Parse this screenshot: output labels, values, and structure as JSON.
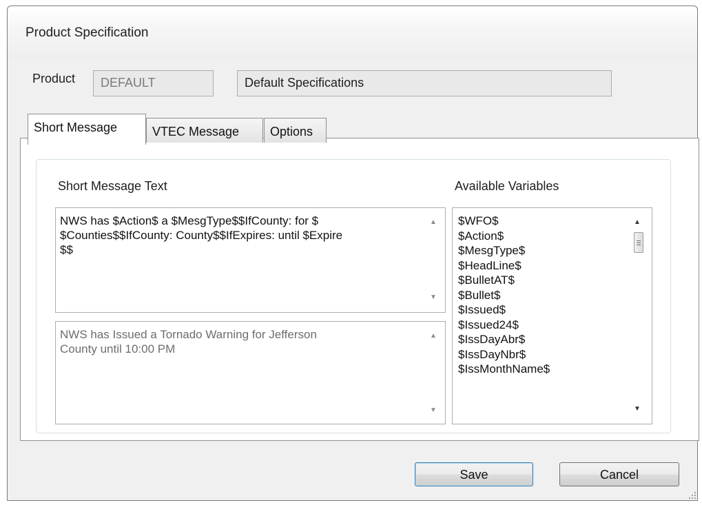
{
  "window": {
    "title": "Product Specification"
  },
  "product": {
    "label": "Product",
    "code": "DEFAULT",
    "description": "Default Specifications"
  },
  "tabs": [
    {
      "label": "Short Message",
      "active": true
    },
    {
      "label": "VTEC Message",
      "active": false
    },
    {
      "label": "Options",
      "active": false
    }
  ],
  "short_message": {
    "heading": "Short Message Text",
    "template": "NWS has $Action$ a $MesgType$$IfCounty: for $\n$Counties$$IfCounty: County$$IfExpires: until $Expire\n$$",
    "preview": "NWS has Issued a Tornado Warning for Jefferson\nCounty until 10:00 PM"
  },
  "variables": {
    "heading": "Available Variables",
    "items": [
      "$WFO$",
      "$Action$",
      "$MesgType$",
      "$HeadLine$",
      "$BulletAT$",
      "$Bullet$",
      "$Issued$",
      "$Issued24$",
      "$IssDayAbr$",
      "$IssDayNbr$",
      "$IssMonthName$"
    ]
  },
  "buttons": {
    "save": "Save",
    "cancel": "Cancel"
  },
  "icons": {
    "scroll_up": "scroll-up-arrow-icon",
    "scroll_down": "scroll-down-arrow-icon",
    "size_grip": "size-grip-icon"
  }
}
